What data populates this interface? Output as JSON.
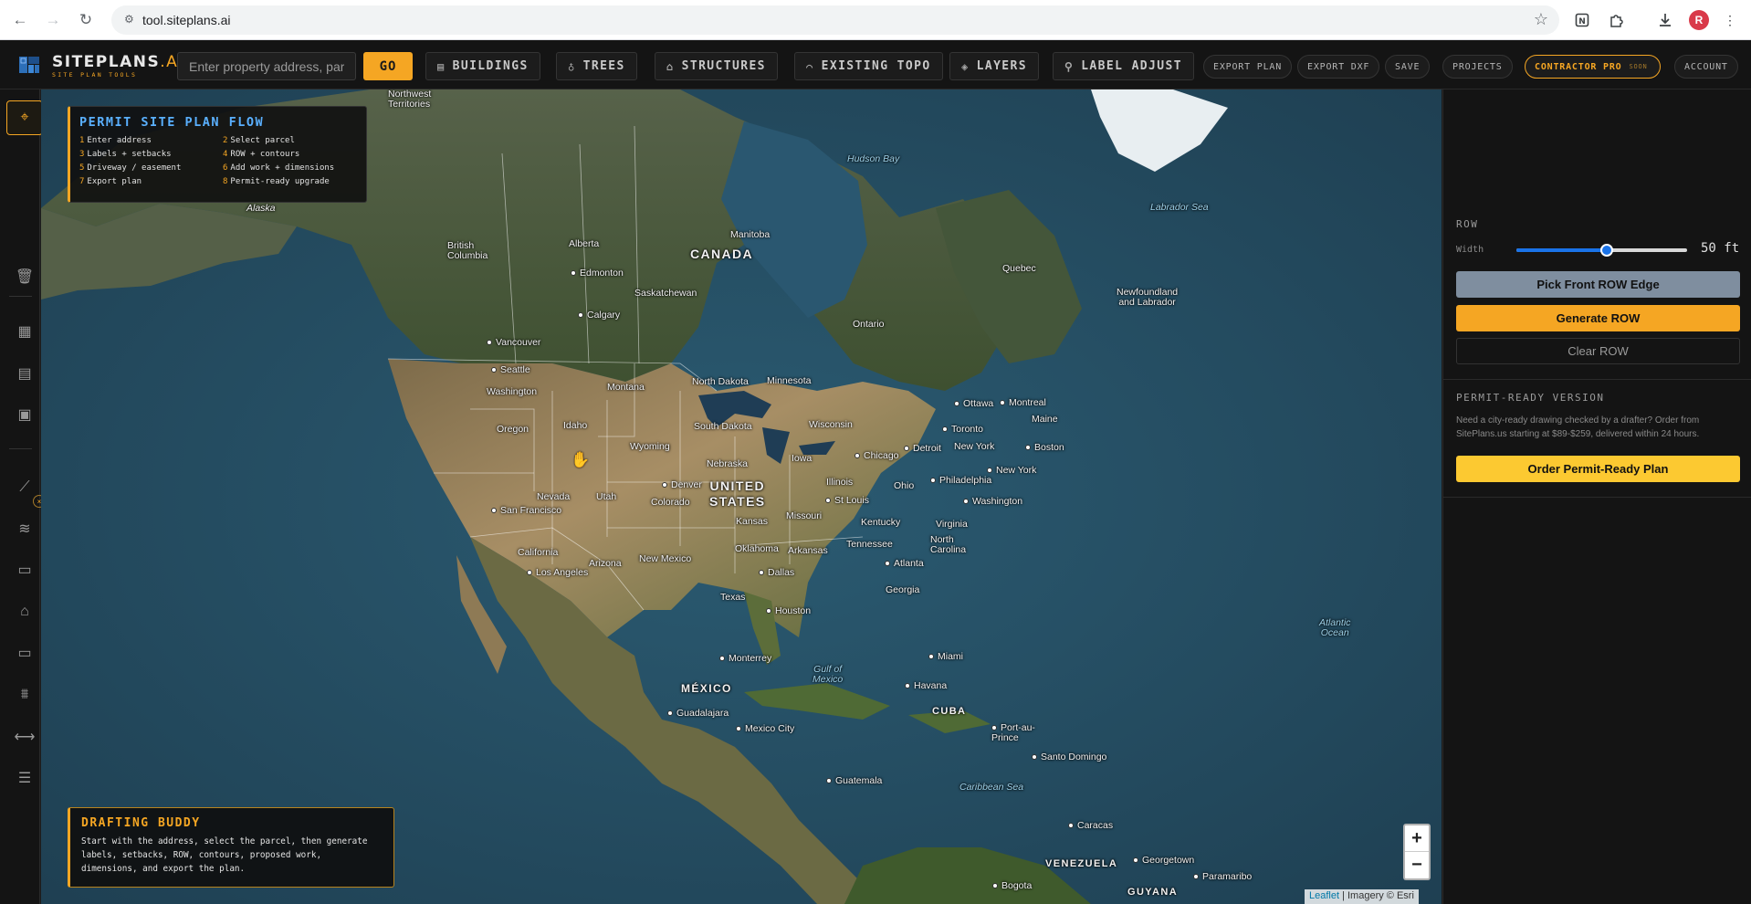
{
  "browser": {
    "url": "tool.siteplans.ai",
    "profile_initial": "R"
  },
  "header": {
    "logo_main": "SITEPLANS",
    "logo_ai": ".AI",
    "logo_sub": "SITE PLAN TOOLS",
    "address_placeholder": "Enter property address, par",
    "go_label": "GO",
    "tools": [
      "BUILDINGS",
      "TREES",
      "STRUCTURES",
      "EXISTING TOPO",
      "LAYERS",
      "LABEL ADJUST"
    ],
    "actions": [
      "EXPORT PLAN",
      "EXPORT DXF",
      "SAVE",
      "PROJECTS"
    ],
    "pro_label": "CONTRACTOR PRO",
    "pro_soon": "SOON",
    "account_label": "ACCOUNT"
  },
  "flow": {
    "title": "PERMIT SITE PLAN FLOW",
    "steps": [
      {
        "n": "1",
        "text": "Enter address"
      },
      {
        "n": "2",
        "text": "Select parcel"
      },
      {
        "n": "3",
        "text": "Labels + setbacks"
      },
      {
        "n": "4",
        "text": "ROW + contours"
      },
      {
        "n": "5",
        "text": "Driveway / easement"
      },
      {
        "n": "6",
        "text": "Add work + dimensions"
      },
      {
        "n": "7",
        "text": "Export plan"
      },
      {
        "n": "8",
        "text": "Permit-ready upgrade"
      }
    ]
  },
  "buddy": {
    "title": "DRAFTING BUDDY",
    "text": "Start with the address, select the parcel, then generate labels, setbacks, ROW, contours, proposed work, dimensions, and export the plan."
  },
  "map": {
    "zoom_in": "+",
    "zoom_out": "−",
    "attribution_leaflet": "Leaflet",
    "attribution_rest": " | Imagery © Esri",
    "labels": {
      "northwest_territories": "Northwest\nTerritories",
      "alaska": "Alaska",
      "british_columbia": "British\nColumbia",
      "alberta": "Alberta",
      "edmonton": "Edmonton",
      "calgary": "Calgary",
      "vancouver": "Vancouver",
      "seattle": "Seattle",
      "washington_state": "Washington",
      "oregon": "Oregon",
      "idaho": "Idaho",
      "montana": "Montana",
      "wyoming": "Wyoming",
      "nevada": "Nevada",
      "utah": "Utah",
      "san_francisco": "San Francisco",
      "california": "California",
      "los_angeles": "Los Angeles",
      "arizona": "Arizona",
      "new_mexico": "New Mexico",
      "colorado": "Colorado",
      "denver": "Denver",
      "saskatchewan": "Saskatchewan",
      "manitoba": "Manitoba",
      "canada": "CANADA",
      "hudson_bay": "Hudson Bay",
      "labrador_sea": "Labrador Sea",
      "quebec": "Quebec",
      "ontario": "Ontario",
      "newfoundland": "Newfoundland\nand Labrador",
      "north_dakota": "North Dakota",
      "south_dakota": "South Dakota",
      "minnesota": "Minnesota",
      "wisconsin": "Wisconsin",
      "nebraska": "Nebraska",
      "iowa": "Iowa",
      "kansas": "Kansas",
      "united_states": "UNITED\nSTATES",
      "missouri": "Missouri",
      "illinois": "Illinois",
      "st_louis": "St Louis",
      "chicago": "Chicago",
      "detroit": "Detroit",
      "toronto": "Toronto",
      "ottawa": "Ottawa",
      "montreal": "Montreal",
      "maine": "Maine",
      "boston": "Boston",
      "new_york_state": "New York",
      "new_york_city": "New York",
      "ohio": "Ohio",
      "philadelphia": "Philadelphia",
      "washington_dc": "Washington",
      "kentucky": "Kentucky",
      "virginia": "Virginia",
      "tennessee": "Tennessee",
      "north_carolina": "North\nCarolina",
      "oklahoma": "Oklahoma",
      "arkansas": "Arkansas",
      "dallas": "Dallas",
      "atlanta": "Atlanta",
      "georgia": "Georgia",
      "texas": "Texas",
      "houston": "Houston",
      "miami": "Miami",
      "gulf_of_mexico": "Gulf of\nMexico",
      "monterrey": "Monterrey",
      "mexico": "MÉXICO",
      "guadalajara": "Guadalajara",
      "mexico_city": "Mexico City",
      "havana": "Havana",
      "cuba": "CUBA",
      "port_au_prince": "Port-au-\nPrince",
      "santo_domingo": "Santo Domingo",
      "caribbean_sea": "Caribbean Sea",
      "guatemala": "Guatemala",
      "atlantic_ocean": "Atlantic\nOcean",
      "caracas": "Caracas",
      "venezuela": "VENEZUELA",
      "georgetown": "Georgetown",
      "paramaribo": "Paramaribo",
      "guyana": "GUYANA",
      "bogota": "Bogota"
    }
  },
  "right_panel": {
    "row_title": "ROW",
    "width_label": "Width",
    "width_value": "50 ft",
    "width_slider_fraction": 0.53,
    "pick_front": "Pick Front ROW Edge",
    "generate": "Generate ROW",
    "clear": "Clear ROW",
    "permit_title": "PERMIT-READY VERSION",
    "permit_desc": "Need a city-ready drawing checked by a drafter? Order from SitePlans.us starting at $89-$259, delivered within 24 hours.",
    "order_btn": "Order Permit-Ready Plan"
  },
  "colors": {
    "accent": "#f5a623",
    "flow_title": "#5ab0ff",
    "slider": "#1a73e8",
    "pick_btn": "#7f8e9f",
    "order_btn": "#fcc931"
  }
}
